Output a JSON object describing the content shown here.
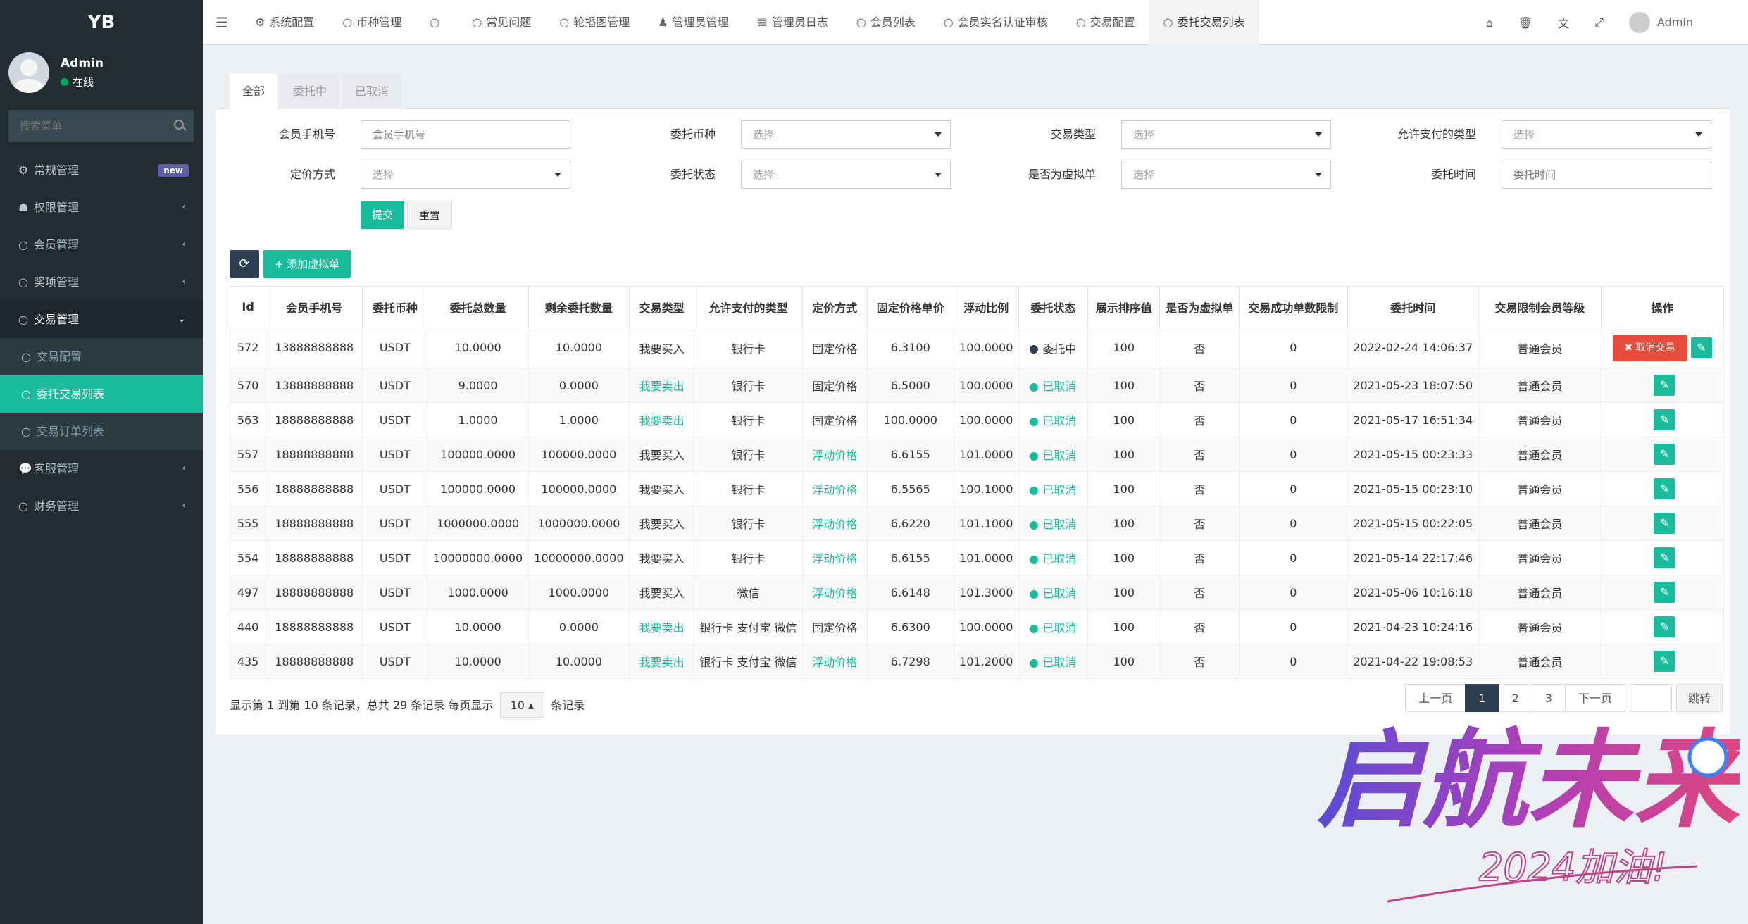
{
  "sidebar": {
    "logo": "YB",
    "user": {
      "name": "Admin",
      "status": "在线"
    },
    "search_placeholder": "搜索菜单",
    "items": [
      {
        "label": "常规管理",
        "badge": "new"
      },
      {
        "label": "权限管理"
      },
      {
        "label": "会员管理"
      },
      {
        "label": "奖项管理"
      },
      {
        "label": "交易管理",
        "children": [
          {
            "label": "交易配置"
          },
          {
            "label": "委托交易列表"
          },
          {
            "label": "交易订单列表"
          }
        ]
      },
      {
        "label": "客服管理"
      },
      {
        "label": "财务管理"
      }
    ]
  },
  "topbar": {
    "tabs": [
      "系统配置",
      "币种管理",
      "",
      "常见问题",
      "轮播图管理",
      "管理员管理",
      "管理员日志",
      "会员列表",
      "会员实名认证审核",
      "交易配置",
      "委托交易列表"
    ],
    "admin": "Admin"
  },
  "content_tabs": [
    "全部",
    "委托中",
    "已取消"
  ],
  "filters": {
    "labels": [
      "会员手机号",
      "委托币种",
      "交易类型",
      "允许支付的类型",
      "定价方式",
      "委托状态",
      "是否为虚拟单",
      "委托时间"
    ],
    "placeholders": {
      "phone": "会员手机号",
      "time": "委托时间"
    },
    "select_text": "选择",
    "submit": "提交",
    "reset": "重置"
  },
  "toolbar": {
    "add": "添加虚拟单"
  },
  "table": {
    "headers": [
      "Id",
      "会员手机号",
      "委托币种",
      "委托总数量",
      "剩余委托数量",
      "交易类型",
      "允许支付的类型",
      "定价方式",
      "固定价格单价",
      "浮动比例",
      "委托状态",
      "展示排序值",
      "是否为虚拟单",
      "交易成功单数限制",
      "委托时间",
      "交易限制会员等级",
      "操作"
    ],
    "rows": [
      [
        "572",
        "13888888888",
        "USDT",
        "10.0000",
        "10.0000",
        "我要买入",
        "银行卡",
        "固定价格",
        "6.3100",
        "100.0000",
        "委托中",
        "100",
        "否",
        "0",
        "2022-02-24 14:06:37",
        "普通会员"
      ],
      [
        "570",
        "13888888888",
        "USDT",
        "9.0000",
        "0.0000",
        "我要卖出",
        "银行卡",
        "固定价格",
        "6.5000",
        "100.0000",
        "已取消",
        "100",
        "否",
        "0",
        "2021-05-23 18:07:50",
        "普通会员"
      ],
      [
        "563",
        "18888888888",
        "USDT",
        "1.0000",
        "1.0000",
        "我要卖出",
        "银行卡",
        "固定价格",
        "100.0000",
        "100.0000",
        "已取消",
        "100",
        "否",
        "0",
        "2021-05-17 16:51:34",
        "普通会员"
      ],
      [
        "557",
        "18888888888",
        "USDT",
        "100000.0000",
        "100000.0000",
        "我要买入",
        "银行卡",
        "浮动价格",
        "6.6155",
        "101.0000",
        "已取消",
        "100",
        "否",
        "0",
        "2021-05-15 00:23:33",
        "普通会员"
      ],
      [
        "556",
        "18888888888",
        "USDT",
        "100000.0000",
        "100000.0000",
        "我要买入",
        "银行卡",
        "浮动价格",
        "6.5565",
        "100.1000",
        "已取消",
        "100",
        "否",
        "0",
        "2021-05-15 00:23:10",
        "普通会员"
      ],
      [
        "555",
        "18888888888",
        "USDT",
        "1000000.0000",
        "1000000.0000",
        "我要买入",
        "银行卡",
        "浮动价格",
        "6.6220",
        "101.1000",
        "已取消",
        "100",
        "否",
        "0",
        "2021-05-15 00:22:05",
        "普通会员"
      ],
      [
        "554",
        "18888888888",
        "USDT",
        "10000000.0000",
        "10000000.0000",
        "我要买入",
        "银行卡",
        "浮动价格",
        "6.6155",
        "101.0000",
        "已取消",
        "100",
        "否",
        "0",
        "2021-05-14 22:17:46",
        "普通会员"
      ],
      [
        "497",
        "18888888888",
        "USDT",
        "1000.0000",
        "1000.0000",
        "我要买入",
        "微信",
        "浮动价格",
        "6.6148",
        "101.3000",
        "已取消",
        "100",
        "否",
        "0",
        "2021-05-06 10:16:18",
        "普通会员"
      ],
      [
        "440",
        "18888888888",
        "USDT",
        "10.0000",
        "0.0000",
        "我要卖出",
        "银行卡 支付宝 微信",
        "固定价格",
        "6.6300",
        "100.0000",
        "已取消",
        "100",
        "否",
        "0",
        "2021-04-23 10:24:16",
        "普通会员"
      ],
      [
        "435",
        "18888888888",
        "USDT",
        "10.0000",
        "10.0000",
        "我要卖出",
        "银行卡 支付宝 微信",
        "浮动价格",
        "6.7298",
        "101.2000",
        "已取消",
        "100",
        "否",
        "0",
        "2021-04-22 19:08:53",
        "普通会员"
      ]
    ],
    "cancel_label": "取消交易"
  },
  "pagination": {
    "info": "显示第 1 到第 10 条记录，总共 29 条记录 每页显示",
    "per_page": "10",
    "suffix": "条记录",
    "prev": "上一页",
    "pages": [
      "1",
      "2",
      "3"
    ],
    "next": "下一页",
    "go": "跳转"
  },
  "watermark": {
    "main": "启航未来",
    "sub": "2024加油!"
  },
  "colors": {
    "accent": "#1abc9c",
    "sidebar": "#222d32",
    "danger": "#e74c3c",
    "dark": "#2c3e50"
  }
}
